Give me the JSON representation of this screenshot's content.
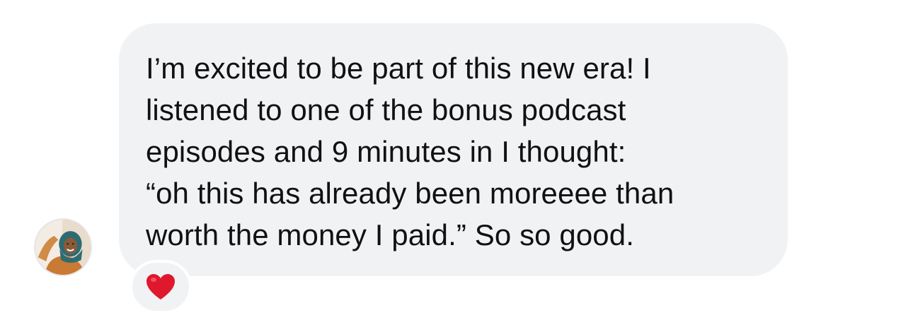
{
  "message": {
    "text": "I’m excited to be part of this new era! I\nlistened to one of the bonus podcast\nepisodes and 9 minutes in I thought:\n“oh this has already been moreeee than\nworth the money I paid.” So so good.",
    "reaction": "heart-icon",
    "reaction_color": "#e0182d",
    "bubble_color": "#f1f2f4"
  },
  "sender": {
    "avatar": "avatar"
  }
}
